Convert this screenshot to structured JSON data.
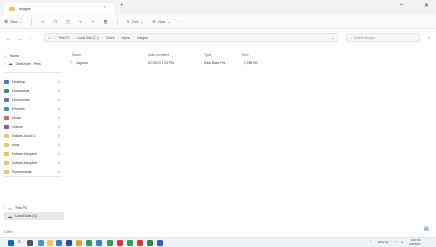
{
  "window": {
    "tab_title": "Images",
    "tab_close": "×",
    "new_tab": "+",
    "minimize": "–",
    "close": "✕"
  },
  "command_bar": {
    "new_label": "New",
    "sort_label": "Sort",
    "view_label": "View",
    "more_label": "···"
  },
  "address": {
    "crumbs": [
      "This PC",
      "Local Disk (C:)",
      "Users",
      "rayha",
      "Images"
    ],
    "search_placeholder": "Search Images"
  },
  "sidebar": {
    "home": "Home",
    "onedrive": "OneDrive - Pers",
    "quick": [
      {
        "label": "Desktop",
        "color": "#3b82c4"
      },
      {
        "label": "Downloads",
        "color": "#2a9d5c"
      },
      {
        "label": "Documents",
        "color": "#5a7fb5"
      },
      {
        "label": "Pictures",
        "color": "#3a8fd8"
      },
      {
        "label": "Music",
        "color": "#e0603a"
      },
      {
        "label": "Videos",
        "color": "#8a4fc4"
      },
      {
        "label": "Dollars Acad Ll",
        "color": "#f2c45f"
      },
      {
        "label": "docs",
        "color": "#f2c45f"
      },
      {
        "label": "Dollars Adopted",
        "color": "#f2c45f"
      },
      {
        "label": "Dollars Adopted",
        "color": "#f2c45f"
      },
      {
        "label": "Screenshots",
        "color": "#f2c45f"
      }
    ],
    "this_pc": "This PC",
    "local_disk": "Local Disk (C)"
  },
  "columns": {
    "name": "Name",
    "date": "Date modified",
    "type": "Type",
    "size": "Size"
  },
  "files": [
    {
      "name": "imgdata",
      "date": "6/7/2023 1:00 PM",
      "type": "Data Base File",
      "size": "1,095 KB"
    }
  ],
  "status": {
    "items": "1 item"
  },
  "tray": {
    "lang": "ENG IN",
    "time": "9:00 PM",
    "date": "2/28/2023"
  },
  "colors": {
    "accent": "#0067c0",
    "folder": "#f2c45f"
  }
}
